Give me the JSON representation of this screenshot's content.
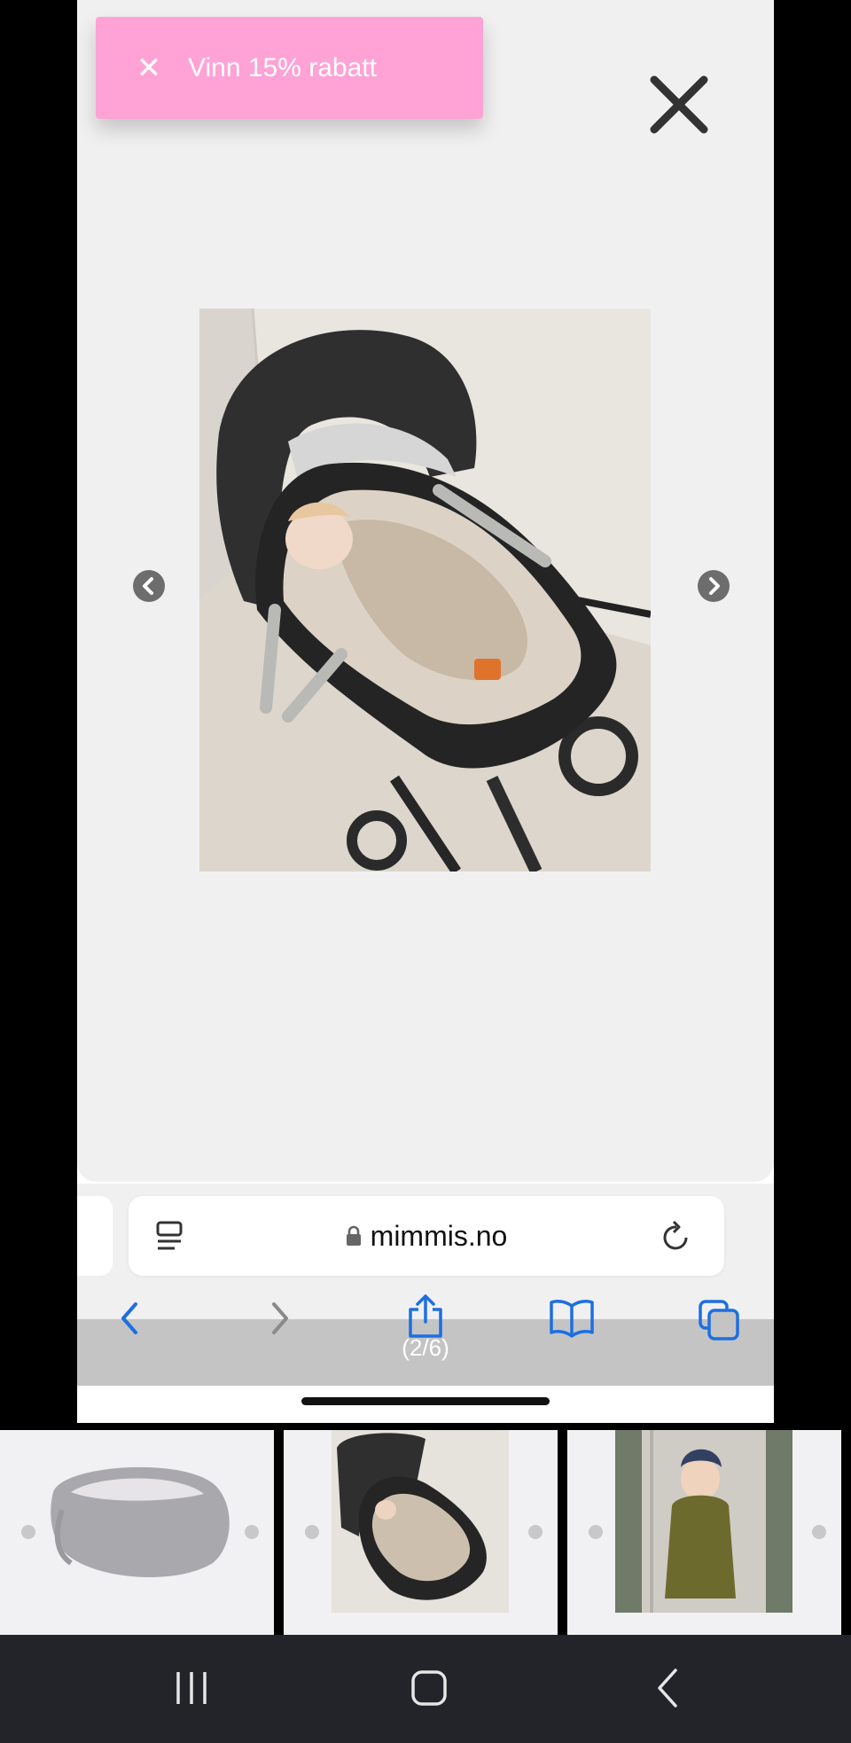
{
  "promo": {
    "close_icon": "close-icon",
    "label": "Vinn 15% rabatt"
  },
  "lightbox": {
    "close_icon": "close-icon",
    "prev_icon": "chevron-left-icon",
    "next_icon": "chevron-right-icon",
    "counter": "(2/6)",
    "image_subject": "baby sleeping in carrycot on stroller"
  },
  "browser": {
    "url": "mimmis.no",
    "reader_icon": "reader-mode-icon",
    "lock_icon": "lock-icon",
    "reload_icon": "reload-icon",
    "toolbar": [
      "back-icon",
      "forward-icon",
      "share-icon",
      "bookmarks-icon",
      "tabs-icon"
    ]
  },
  "thumbnails": [
    {
      "subject": "grey baby carrycot"
    },
    {
      "subject": "baby sleeping in carrycot on stroller"
    },
    {
      "subject": "baby in olive suit in carrycot"
    }
  ],
  "android_nav": [
    "recents-icon",
    "home-icon",
    "back-icon"
  ],
  "colors": {
    "promo_bg": "#ffa2d5",
    "accent_blue": "#1d6fe0",
    "modal_bg": "#f0f0f1",
    "nav_bg": "#23232a"
  }
}
